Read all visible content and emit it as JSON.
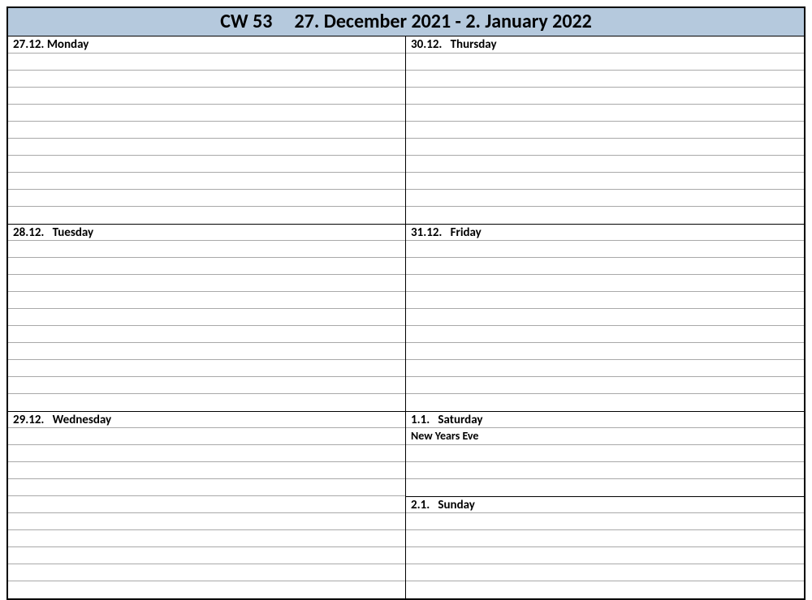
{
  "title": "CW 53     27. December 2021 - 2. January 2022",
  "left_column": [
    {
      "header": "27.12. Monday",
      "rows": [
        "",
        "",
        "",
        "",
        "",
        "",
        "",
        "",
        "",
        ""
      ]
    },
    {
      "header": "28.12.   Tuesday",
      "rows": [
        "",
        "",
        "",
        "",
        "",
        "",
        "",
        "",
        "",
        ""
      ]
    },
    {
      "header": "29.12.   Wednesday",
      "rows": [
        "",
        "",
        "",
        "",
        "",
        "",
        "",
        "",
        "",
        ""
      ]
    }
  ],
  "right_column": [
    {
      "header": "30.12.   Thursday",
      "rows": [
        "",
        "",
        "",
        "",
        "",
        "",
        "",
        "",
        "",
        ""
      ]
    },
    {
      "header": "31.12.   Friday",
      "rows": [
        "",
        "",
        "",
        "",
        "",
        "",
        "",
        "",
        "",
        ""
      ]
    },
    {
      "header": "1.1.   Saturday",
      "rows": [
        "New Years Eve",
        "",
        "",
        ""
      ]
    },
    {
      "header": "2.1.   Sunday",
      "rows": [
        "",
        "",
        "",
        "",
        ""
      ]
    }
  ]
}
